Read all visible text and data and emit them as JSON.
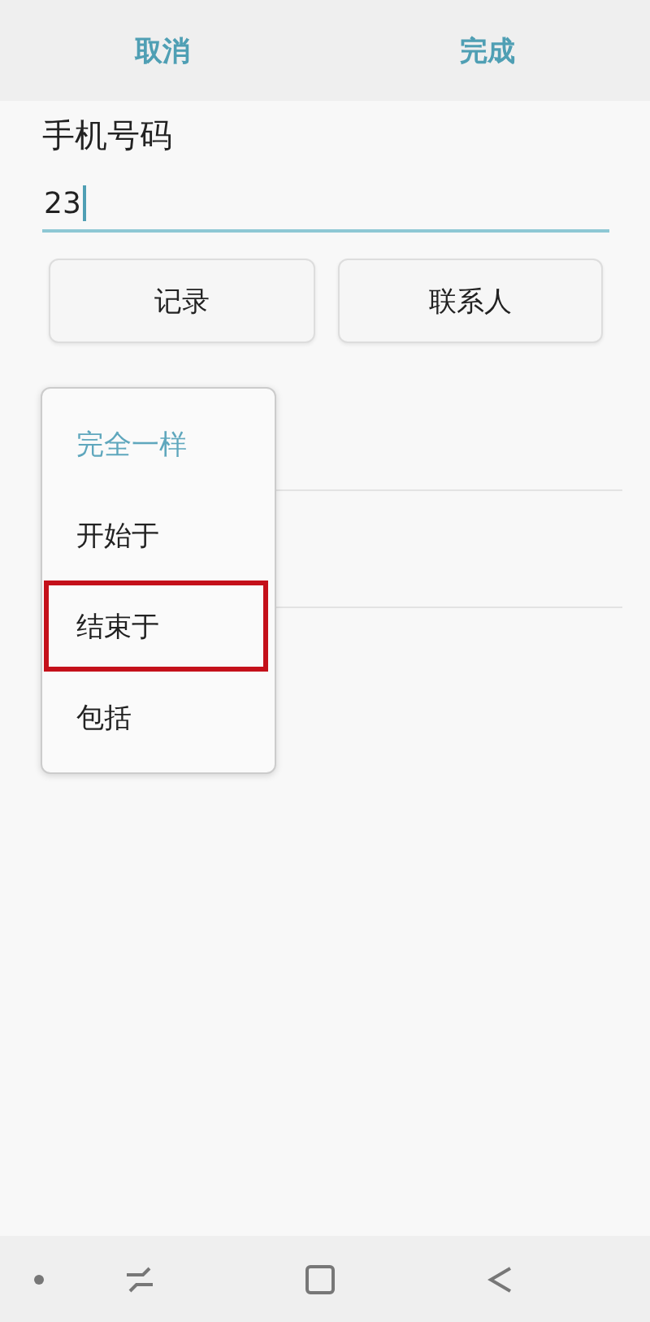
{
  "header": {
    "cancel": "取消",
    "done": "完成"
  },
  "phone_field": {
    "label": "手机号码",
    "value": "23"
  },
  "buttons": [
    "记录",
    "联系人"
  ],
  "match_menu": [
    {
      "label": "完全一样",
      "selected": true,
      "highlighted": false
    },
    {
      "label": "开始于",
      "selected": false,
      "highlighted": false
    },
    {
      "label": "结束于",
      "selected": false,
      "highlighted": true
    },
    {
      "label": "包括",
      "selected": false,
      "highlighted": false
    }
  ]
}
